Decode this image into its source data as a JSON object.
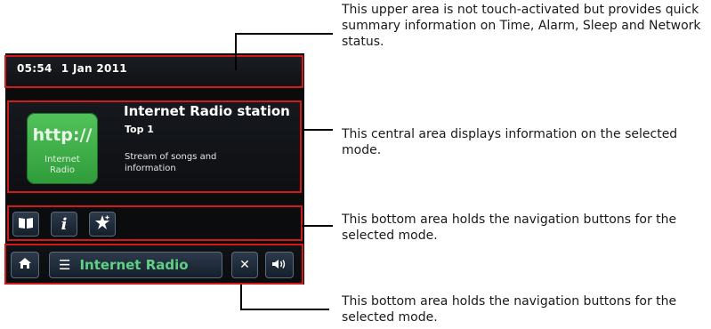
{
  "status_bar": {
    "time": "05:54",
    "date": "1 Jan 2011"
  },
  "main_area": {
    "icon_main_text": "http://",
    "icon_sub_text": "Internet\nRadio",
    "station_title": "Internet Radio station",
    "station_subtitle": "Top 1",
    "station_description": "Stream of songs and information"
  },
  "nav_top": {
    "buttons": [
      "book-icon",
      "info-icon",
      "star-icon"
    ]
  },
  "nav_bottom": {
    "mode_label": "Internet Radio",
    "buttons": [
      "home-icon",
      "menu-icon",
      "close-icon",
      "volume-icon"
    ]
  },
  "callouts": {
    "top": "This upper area is not touch-activated but provides quick summary information on Time, Alarm, Sleep and Network status.",
    "center": "This central area displays information on the selected mode.",
    "nav": "This bottom area holds the navigation buttons for the selected mode.",
    "bottom": "This bottom area holds the navigation buttons for the selected mode."
  },
  "colors": {
    "highlight": "#d11a1a",
    "mode_text": "#5fd184",
    "icon_green": "#3faa48"
  }
}
